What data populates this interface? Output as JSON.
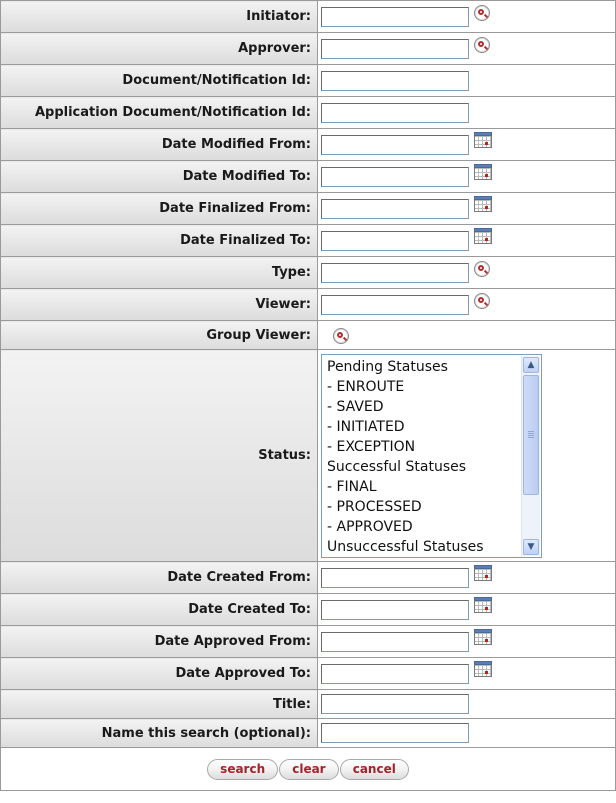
{
  "fields": {
    "initiator": "Initiator:",
    "approver": "Approver:",
    "document_id": "Document/Notification Id:",
    "app_document_id": "Application Document/Notification Id:",
    "date_modified_from": "Date Modified From:",
    "date_modified_to": "Date Modified To:",
    "date_finalized_from": "Date Finalized From:",
    "date_finalized_to": "Date Finalized To:",
    "type": "Type:",
    "viewer": "Viewer:",
    "group_viewer": "Group Viewer:",
    "status": "Status:",
    "date_created_from": "Date Created From:",
    "date_created_to": "Date Created To:",
    "date_approved_from": "Date Approved From:",
    "date_approved_to": "Date Approved To:",
    "title": "Title:",
    "name_search": "Name this search (optional):"
  },
  "status_options": [
    "Pending Statuses",
    "- ENROUTE",
    "- SAVED",
    "- INITIATED",
    "- EXCEPTION",
    "Successful Statuses",
    "- FINAL",
    "- PROCESSED",
    "- APPROVED",
    "Unsuccessful Statuses"
  ],
  "buttons": {
    "search": "search",
    "clear": "clear",
    "cancel": "cancel"
  },
  "icons": {
    "lookup": "magnifier-icon",
    "calendar": "calendar-icon"
  }
}
